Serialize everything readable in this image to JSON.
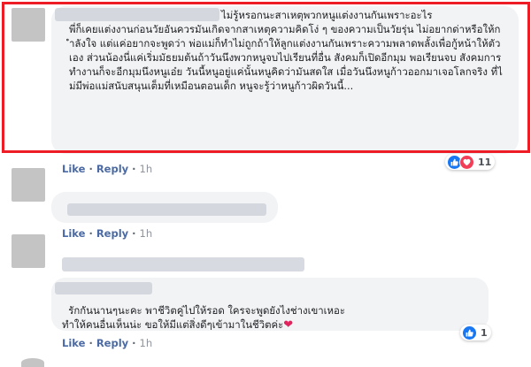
{
  "comments": [
    {
      "text": "ไม่รู้หรอกนะสาเหตุพวกหนูแต่งงานกันเพราะอะไร\nพี่ก็เคยแต่งงานก่อนวัยอันควรมันเกิดจากสาเหตุความคิดโง่ ๆ ของความเป็นวัยรุ่น ไม่อยากด่าหรือให้กำลังใจ แต่แค่อยากจะพูดว่า พ่อแม่ก็ทำไม่ถูกถ้าให้ลูกแต่งงานกันเพราะความพลาดพลั้งเพื่อกู้หน้าให้ตัวเอง ส่วนน้องนี่แค่เริ่มมัธยมต้นถ้าวันนึงพวกหนูจบไปเรียนที่อื่น สังคมก็เปิดอีกมุม พอเรียนจบ สังคมการทำงานก็จะอีกมุมนึงหนูเอ๋ย วันนี้หนูอยู่แค่นั้นหนูคิดว่ามันสดใส เมื่อวันนึงหนูก้าวออกมาเจอโลกจริง ที่ไม่มีพ่อแม่สนับสนุนเต็มที่เหมือนตอนเด็ก หนูจะรู้ว่าหนูก้าวผิดวันนี้...",
      "like": "Like",
      "reply": "Reply",
      "time": "1h",
      "reaction_count": "11"
    },
    {
      "text": "",
      "like": "Like",
      "reply": "Reply",
      "time": "1h"
    },
    {
      "text": "รักกันนานๆนะคะ พาชีวิตคู่ไปให้รอด ใครจะพูดยังไงช่างเขาเหอะ\nทำให้คนอื่นเห็นน่ะ ขอให้มีแต่สิ่งดีๆเข้ามาในชีวิตค่ะ",
      "heart": "❤",
      "like": "Like",
      "reply": "Reply",
      "time": "1h",
      "reaction_count": "1"
    }
  ]
}
